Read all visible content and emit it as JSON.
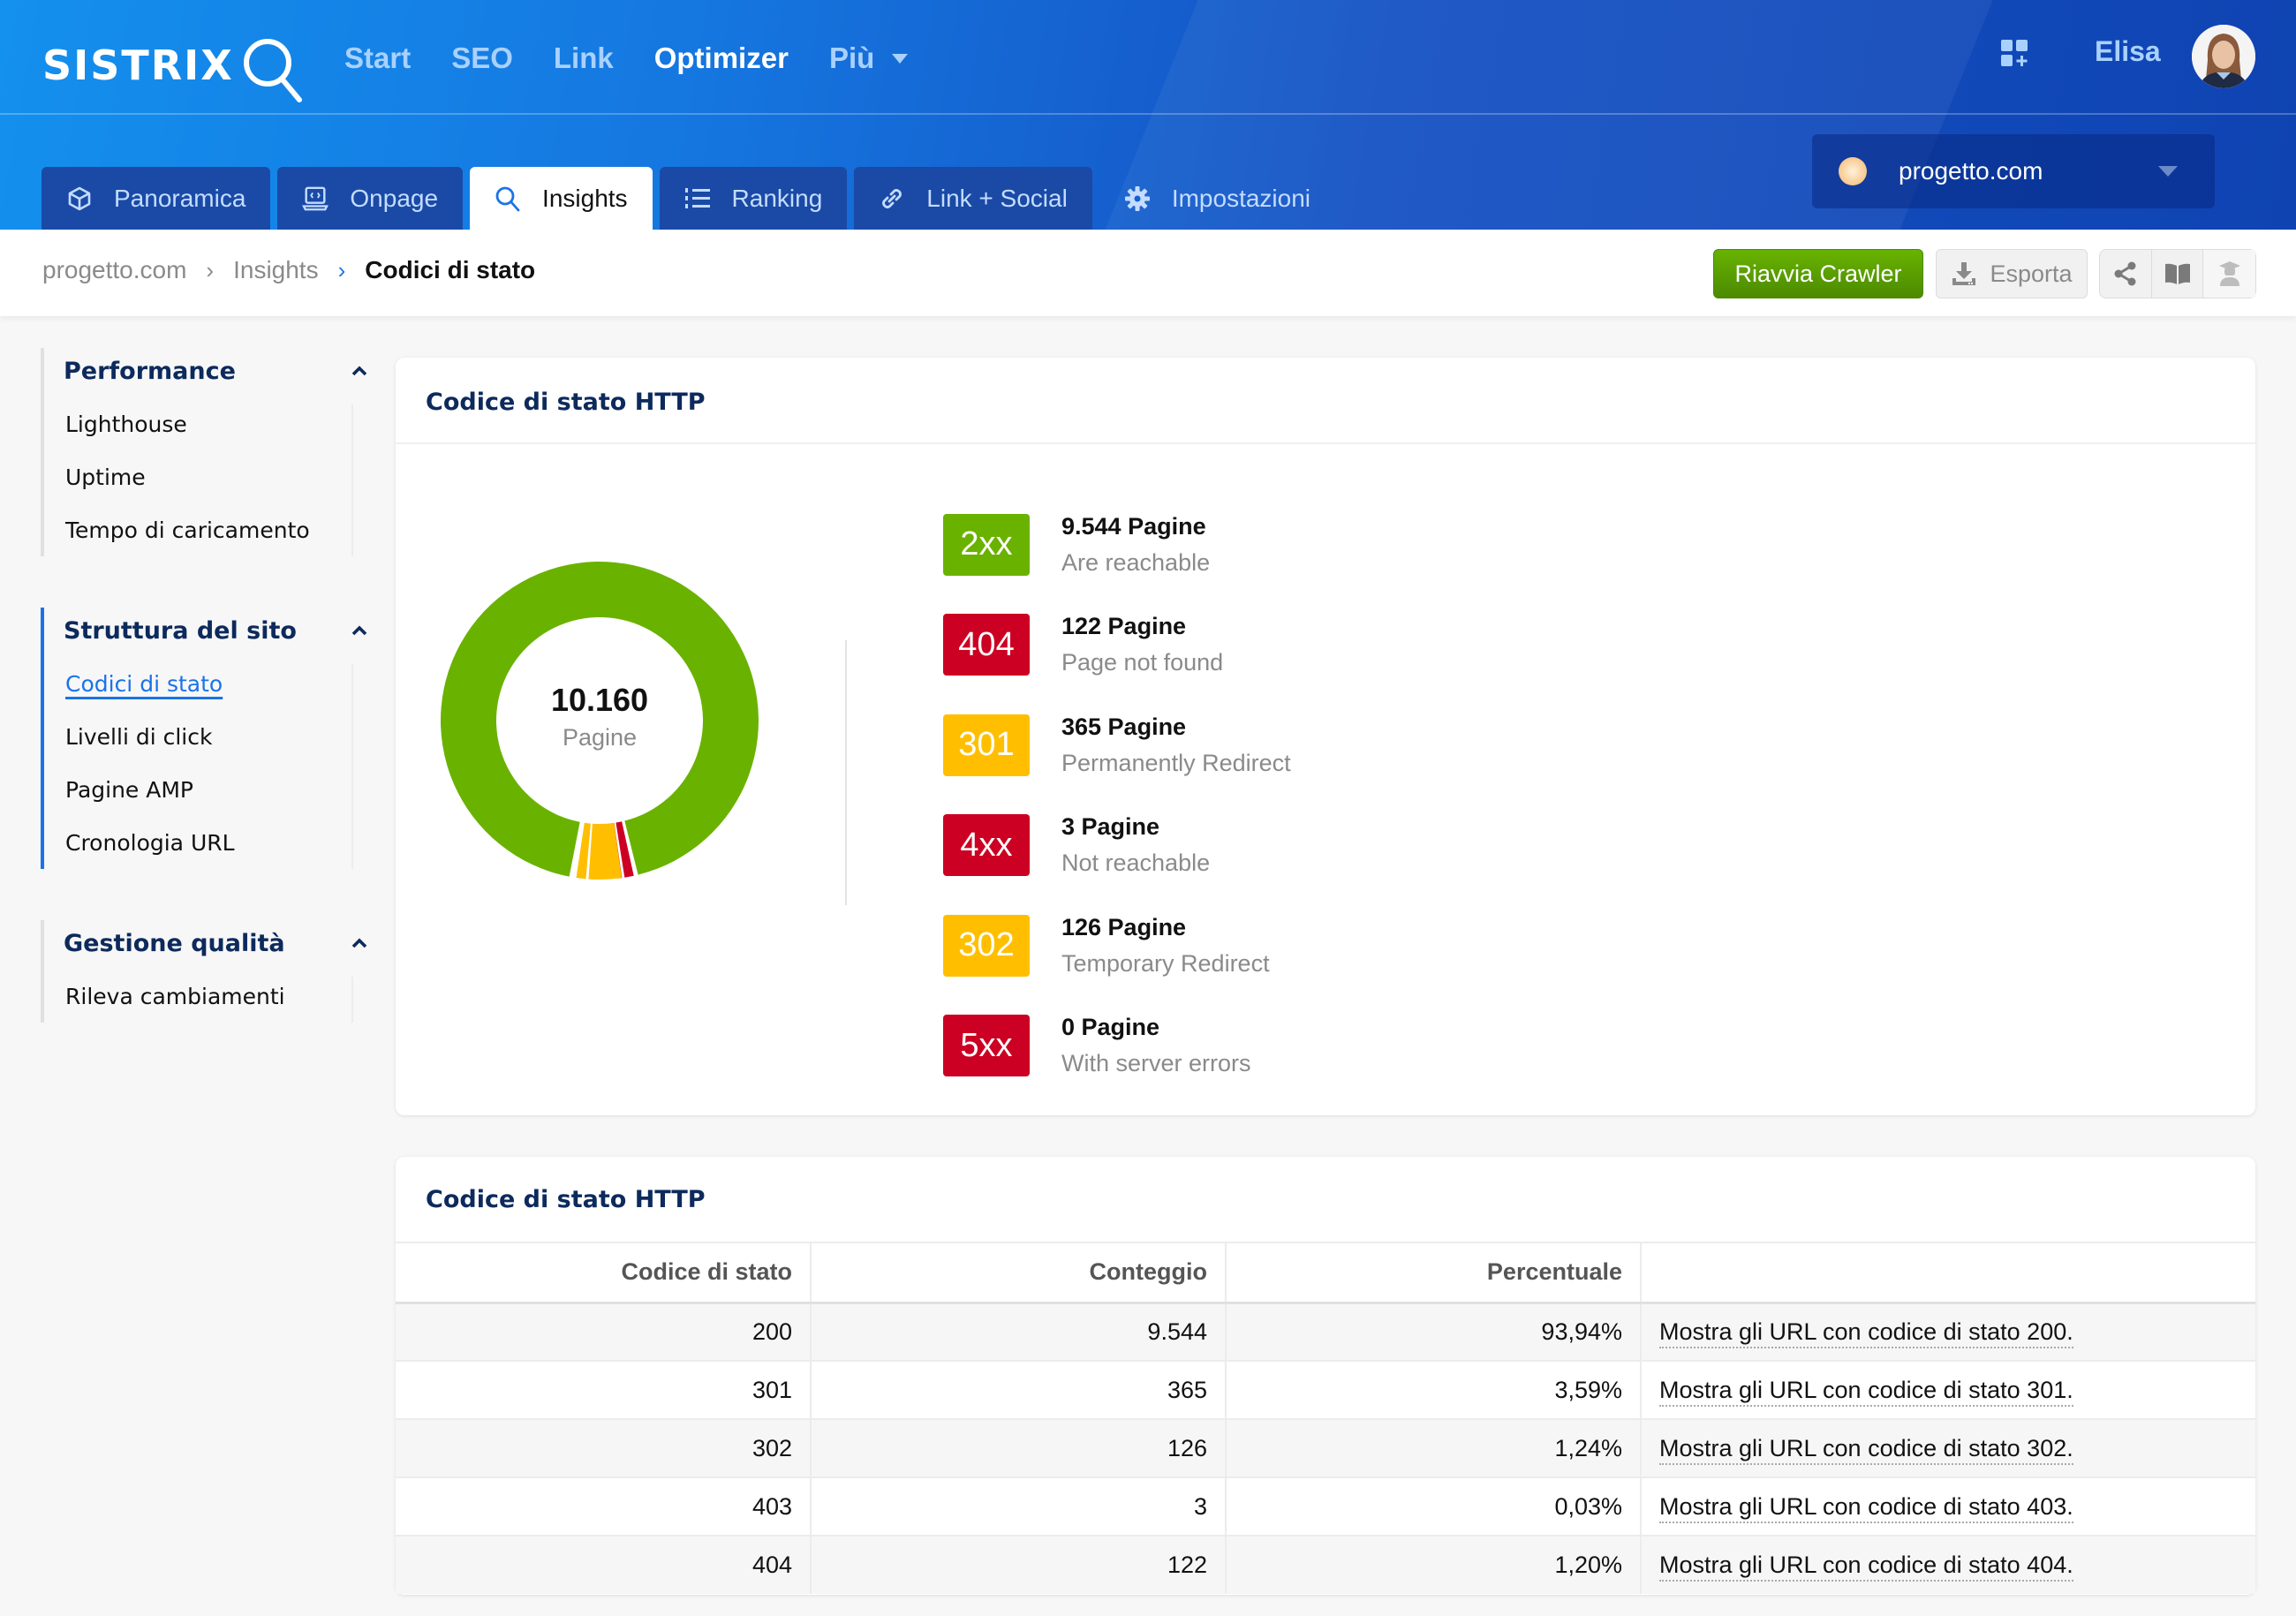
{
  "header": {
    "logo_text": "SISTRIX",
    "nav": [
      {
        "label": "Start",
        "active": false
      },
      {
        "label": "SEO",
        "active": false
      },
      {
        "label": "Link",
        "active": false
      },
      {
        "label": "Optimizer",
        "active": true
      },
      {
        "label": "Più",
        "active": false,
        "dropdown": true
      }
    ],
    "user_name": "Elisa",
    "apps_icon": "apps-add-icon",
    "project": {
      "name": "progetto.com"
    }
  },
  "tabs": [
    {
      "label": "Panoramica",
      "icon": "cube-icon"
    },
    {
      "label": "Onpage",
      "icon": "laptop-code-icon"
    },
    {
      "label": "Insights",
      "icon": "search-icon",
      "active": true
    },
    {
      "label": "Ranking",
      "icon": "list-numbered-icon"
    },
    {
      "label": "Link + Social",
      "icon": "link-icon"
    },
    {
      "label": "Impostazioni",
      "icon": "gear-icon"
    }
  ],
  "breadcrumb": {
    "items": [
      "progetto.com",
      "Insights"
    ],
    "current": "Codici di stato"
  },
  "toolbar": {
    "restart_label": "Riavvia Crawler",
    "export_label": "Esporta"
  },
  "sidebar": {
    "groups": [
      {
        "title": "Performance",
        "items": [
          "Lighthouse",
          "Uptime",
          "Tempo di caricamento"
        ]
      },
      {
        "title": "Struttura del sito",
        "items": [
          "Codici di stato",
          "Livelli di click",
          "Pagine AMP",
          "Cronologia URL"
        ],
        "current": "Codici di stato"
      },
      {
        "title": "Gestione qualità",
        "items": [
          "Rileva cambiamenti"
        ]
      }
    ]
  },
  "overview_card": {
    "title": "Codice di stato HTTP",
    "total": "10.160",
    "total_label": "Pagine",
    "legend": [
      {
        "badge": "2xx",
        "count": "9.544 Pagine",
        "desc": "Are reachable",
        "color": "#6ab200"
      },
      {
        "badge": "404",
        "count": "122 Pagine",
        "desc": "Page not found",
        "color": "#cc0022"
      },
      {
        "badge": "301",
        "count": "365 Pagine",
        "desc": "Permanently Redirect",
        "color": "#ffbf00"
      },
      {
        "badge": "4xx",
        "count": "3 Pagine",
        "desc": "Not reachable",
        "color": "#cc0022"
      },
      {
        "badge": "302",
        "count": "126 Pagine",
        "desc": "Temporary Redirect",
        "color": "#ffbf00"
      },
      {
        "badge": "5xx",
        "count": "0 Pagine",
        "desc": "With server errors",
        "color": "#cc0022"
      }
    ]
  },
  "chart_data": {
    "type": "pie",
    "title": "Codice di stato HTTP",
    "center_label": "10.160 Pagine",
    "categories": [
      "2xx",
      "404",
      "301",
      "4xx",
      "302",
      "5xx"
    ],
    "values": [
      9544,
      122,
      365,
      3,
      126,
      0
    ],
    "colors": [
      "#6ab200",
      "#cc0022",
      "#ffbf00",
      "#cc0022",
      "#ffbf00",
      "#cc0022"
    ],
    "legend": "right"
  },
  "table_card": {
    "title": "Codice di stato HTTP",
    "columns": [
      "Codice di stato",
      "Conteggio",
      "Percentuale",
      ""
    ],
    "rows": [
      {
        "code": "200",
        "count": "9.544",
        "percent": "93,94%",
        "link": "Mostra gli URL con codice di stato 200."
      },
      {
        "code": "301",
        "count": "365",
        "percent": "3,59%",
        "link": "Mostra gli URL con codice di stato 301."
      },
      {
        "code": "302",
        "count": "126",
        "percent": "1,24%",
        "link": "Mostra gli URL con codice di stato 302."
      },
      {
        "code": "403",
        "count": "3",
        "percent": "0,03%",
        "link": "Mostra gli URL con codice di stato 403."
      },
      {
        "code": "404",
        "count": "122",
        "percent": "1,20%",
        "link": "Mostra gli URL con codice di stato 404."
      }
    ]
  }
}
